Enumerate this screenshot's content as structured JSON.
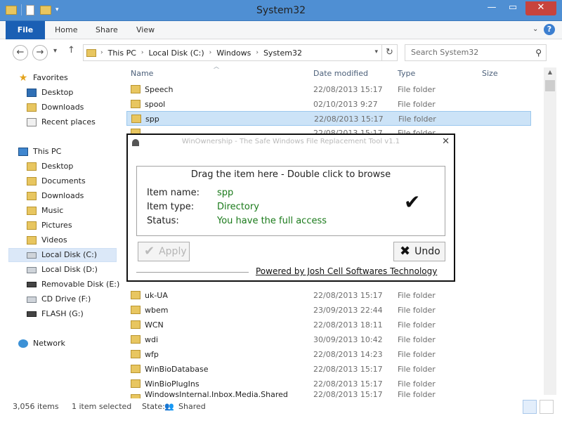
{
  "window": {
    "title": "System32",
    "controls": [
      "—",
      "▭",
      "✕"
    ]
  },
  "ribbon": {
    "tabs": [
      "File",
      "Home",
      "Share",
      "View"
    ],
    "help": "?"
  },
  "address": {
    "crumbs": [
      "This PC",
      "Local Disk (C:)",
      "Windows",
      "System32"
    ],
    "separator": "›"
  },
  "search": {
    "placeholder": "Search System32"
  },
  "navpane": {
    "favorites": {
      "label": "Favorites",
      "items": [
        "Desktop",
        "Downloads",
        "Recent places"
      ]
    },
    "thispc": {
      "label": "This PC",
      "items": [
        "Desktop",
        "Documents",
        "Downloads",
        "Music",
        "Pictures",
        "Videos",
        "Local Disk (C:)",
        "Local Disk (D:)",
        "Removable Disk (E:)",
        "CD Drive (F:)",
        "FLASH (G:)"
      ]
    },
    "network": {
      "label": "Network"
    }
  },
  "columns": {
    "name": "Name",
    "date": "Date modified",
    "type": "Type",
    "size": "Size"
  },
  "files_top": [
    {
      "name": "Speech",
      "date": "22/08/2013 15:17",
      "type": "File folder"
    },
    {
      "name": "spool",
      "date": "02/10/2013 9:27",
      "type": "File folder"
    },
    {
      "name": "spp",
      "date": "22/08/2013 15:17",
      "type": "File folder"
    },
    {
      "name": "",
      "date": "22/08/2013 15:17",
      "type": "File folder"
    }
  ],
  "files_bottom": [
    {
      "name": "uk-UA",
      "date": "22/08/2013 15:17",
      "type": "File folder"
    },
    {
      "name": "wbem",
      "date": "23/09/2013 22:44",
      "type": "File folder"
    },
    {
      "name": "WCN",
      "date": "22/08/2013 18:11",
      "type": "File folder"
    },
    {
      "name": "wdi",
      "date": "30/09/2013 10:42",
      "type": "File folder"
    },
    {
      "name": "wfp",
      "date": "22/08/2013 14:23",
      "type": "File folder"
    },
    {
      "name": "WinBioDatabase",
      "date": "22/08/2013 15:17",
      "type": "File folder"
    },
    {
      "name": "WinBioPlugIns",
      "date": "22/08/2013 15:17",
      "type": "File folder"
    },
    {
      "name": "WindowsInternal.Inbox.Media.Shared",
      "date": "22/08/2013 15:17",
      "type": "File folder"
    }
  ],
  "status": {
    "count": "3,056 items",
    "selected": "1 item selected",
    "state_label": "State:",
    "state_value": "Shared"
  },
  "dialog": {
    "title": "WinOwnership - The Safe Windows File Replacement Tool v1.1",
    "close": "✕",
    "drop_header": "Drag the item here - Double click to browse",
    "fields": [
      {
        "label": "Item name:",
        "value": "spp"
      },
      {
        "label": "Item type:",
        "value": "Directory"
      },
      {
        "label": "Status:",
        "value": "You have the full access"
      }
    ],
    "value_color": "#1a7a1a",
    "check": "✔",
    "apply_label": "Apply",
    "undo_label": "Undo",
    "footer_link": "Powered by Josh Cell Softwares Technology"
  },
  "colors": {
    "titlebar": "#4f8fd3",
    "file_tab": "#1a5fb4",
    "selection": "#cce3f7"
  }
}
